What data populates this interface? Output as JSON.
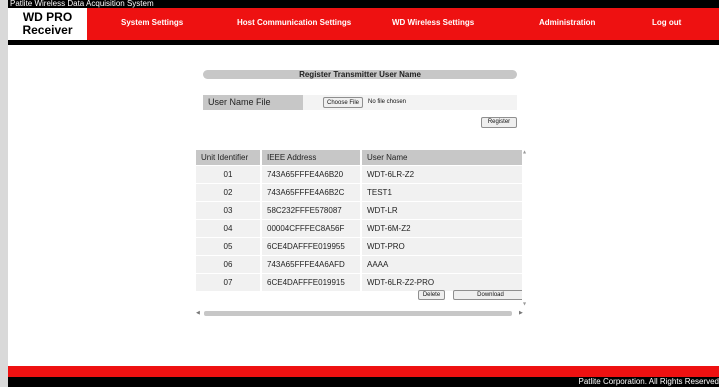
{
  "topbar": {
    "title": "Patlite Wireless Data Acquisition System"
  },
  "logo": {
    "line1": "WD PRO",
    "line2": "Receiver"
  },
  "nav": {
    "system_settings": "System Settings",
    "host_comm": "Host Communication Settings",
    "wd_wireless": "WD Wireless Settings",
    "administration": "Administration",
    "logout": "Log out"
  },
  "register": {
    "title": "Register Transmitter User Name",
    "file_label": "User Name File",
    "choose_file": "Choose File",
    "no_file": "No file chosen",
    "register_button": "Register"
  },
  "table": {
    "headers": {
      "unit": "Unit Identifier",
      "ieee": "IEEE Address",
      "user": "User Name"
    },
    "rows": [
      {
        "unit": "01",
        "ieee": "743A65FFFE4A6B20",
        "user": "WDT-6LR-Z2"
      },
      {
        "unit": "02",
        "ieee": "743A65FFFE4A6B2C",
        "user": "TEST1"
      },
      {
        "unit": "03",
        "ieee": "58C232FFFE578087",
        "user": "WDT-LR"
      },
      {
        "unit": "04",
        "ieee": "00004CFFFEC8A56F",
        "user": "WDT-6M-Z2"
      },
      {
        "unit": "05",
        "ieee": "6CE4DAFFFE019955",
        "user": "WDT-PRO"
      },
      {
        "unit": "06",
        "ieee": "743A65FFFE4A6AFD",
        "user": "AAAA"
      },
      {
        "unit": "07",
        "ieee": "6CE4DAFFFE019915",
        "user": "WDT-6LR-Z2-PRO"
      }
    ],
    "delete_button": "Delete",
    "download_button": "Download"
  },
  "footer": {
    "copyright": "Patlite Corporation. All Rights Reserved"
  },
  "colors": {
    "accent_red": "#ee1111",
    "bar_black": "#000000",
    "panel_gray": "#c7c7c7"
  }
}
